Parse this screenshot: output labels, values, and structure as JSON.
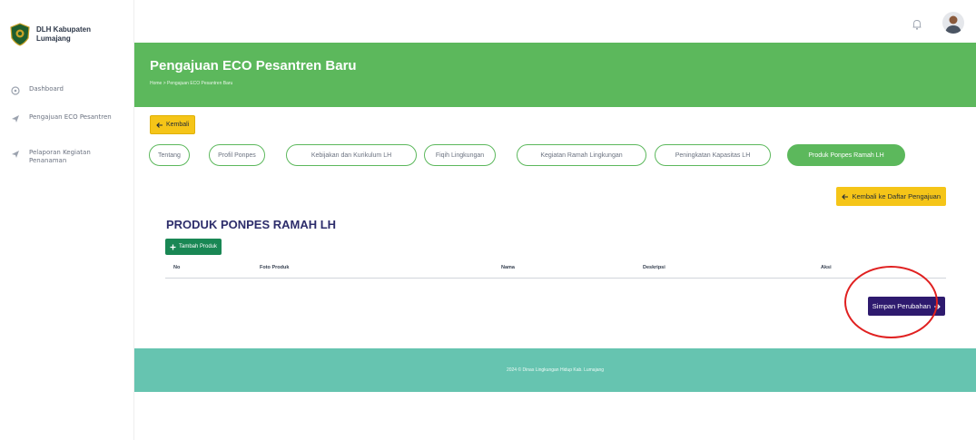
{
  "sidebar": {
    "brand": "DLH Kabupaten Lumajang",
    "items": [
      {
        "label": "Dashboard",
        "icon": "dashboard-icon"
      },
      {
        "label": "Pengajuan ECO Pesantren",
        "icon": "send-icon"
      },
      {
        "label": "Pelaporan Kegiatan Penanaman",
        "icon": "send-icon"
      }
    ]
  },
  "header": {
    "title": "Pengajuan ECO Pesantren Baru",
    "breadcrumb": "Home  >  Pengajuan ECO Pesantren Baru"
  },
  "back_label": "Kembali",
  "tabs": [
    {
      "label": "Tentang"
    },
    {
      "label": "Profil Ponpes"
    },
    {
      "label": "Kebijakan dan Kurikulum LH"
    },
    {
      "label": "Fiqih Lingkungan"
    },
    {
      "label": "Kegiatan Ramah Lingkungan"
    },
    {
      "label": "Peningkatan Kapasitas LH"
    },
    {
      "label": "Produk Ponpes Ramah LH"
    }
  ],
  "card": {
    "back_list_label": "Kembali ke Daftar Pengajuan",
    "section_title": "PRODUK PONPES RAMAH LH",
    "add_label": "Tambah Produk",
    "columns": [
      "No",
      "Foto Produk",
      "Nama",
      "Deskripsi",
      "Aksi"
    ],
    "save_label": "Simpan Perubahan"
  },
  "footer": {
    "text": "2024 © Dinas Lingkungan Hidup Kab. Lumajang"
  },
  "colors": {
    "primary_green": "#5cb85c",
    "footer_teal": "#66c4b0",
    "warning_yellow": "#f5c518",
    "save_purple": "#2e1a6e",
    "add_green": "#198754",
    "annotation_red": "#e02020"
  }
}
